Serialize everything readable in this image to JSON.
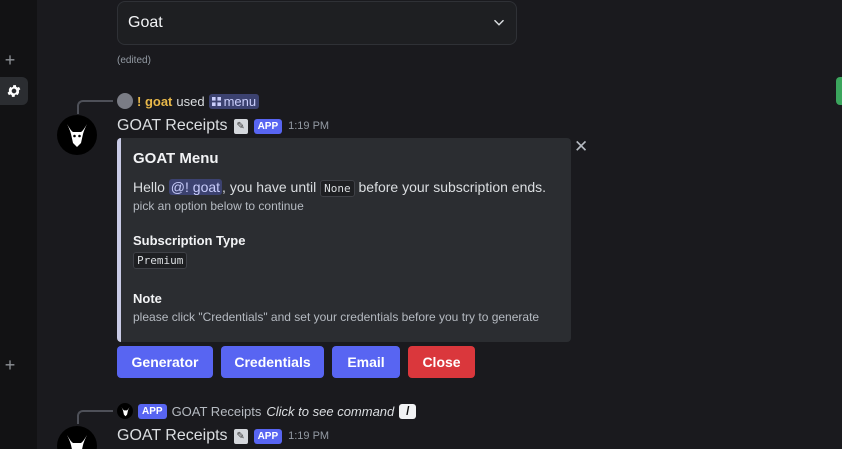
{
  "select": {
    "value": "Goat",
    "icon": "chevron-down-icon"
  },
  "edited_label": "(edited)",
  "interaction": {
    "user": "! goat",
    "used_label": "used",
    "command": "menu"
  },
  "message1": {
    "author": "GOAT Receipts",
    "badge": "APP",
    "timestamp": "1:19 PM"
  },
  "embed": {
    "title": "GOAT Menu",
    "hello": "Hello",
    "mention": "@! goat",
    "until_text": ", you have until",
    "until_value": "None",
    "ends_text": "before your subscription ends.",
    "subtext": "pick an option below to continue",
    "field1_name": "Subscription Type",
    "field1_value": "Premium",
    "field2_name": "Note",
    "field2_value": "please click \"Credentials\" and set your credentials before you try to generate",
    "accent_color": "#c9cbe6"
  },
  "buttons": [
    {
      "label": "Generator",
      "style": "blue"
    },
    {
      "label": "Credentials",
      "style": "blue"
    },
    {
      "label": "Email",
      "style": "blue"
    },
    {
      "label": "Close",
      "style": "red"
    }
  ],
  "interaction2": {
    "badge": "APP",
    "author": "GOAT Receipts",
    "text": "Click to see command"
  },
  "message2": {
    "author": "GOAT Receipts",
    "badge": "APP",
    "timestamp": "1:19 PM"
  },
  "colors": {
    "blurple": "#5865f2",
    "danger": "#da373c",
    "background": "#1a1a1e"
  }
}
